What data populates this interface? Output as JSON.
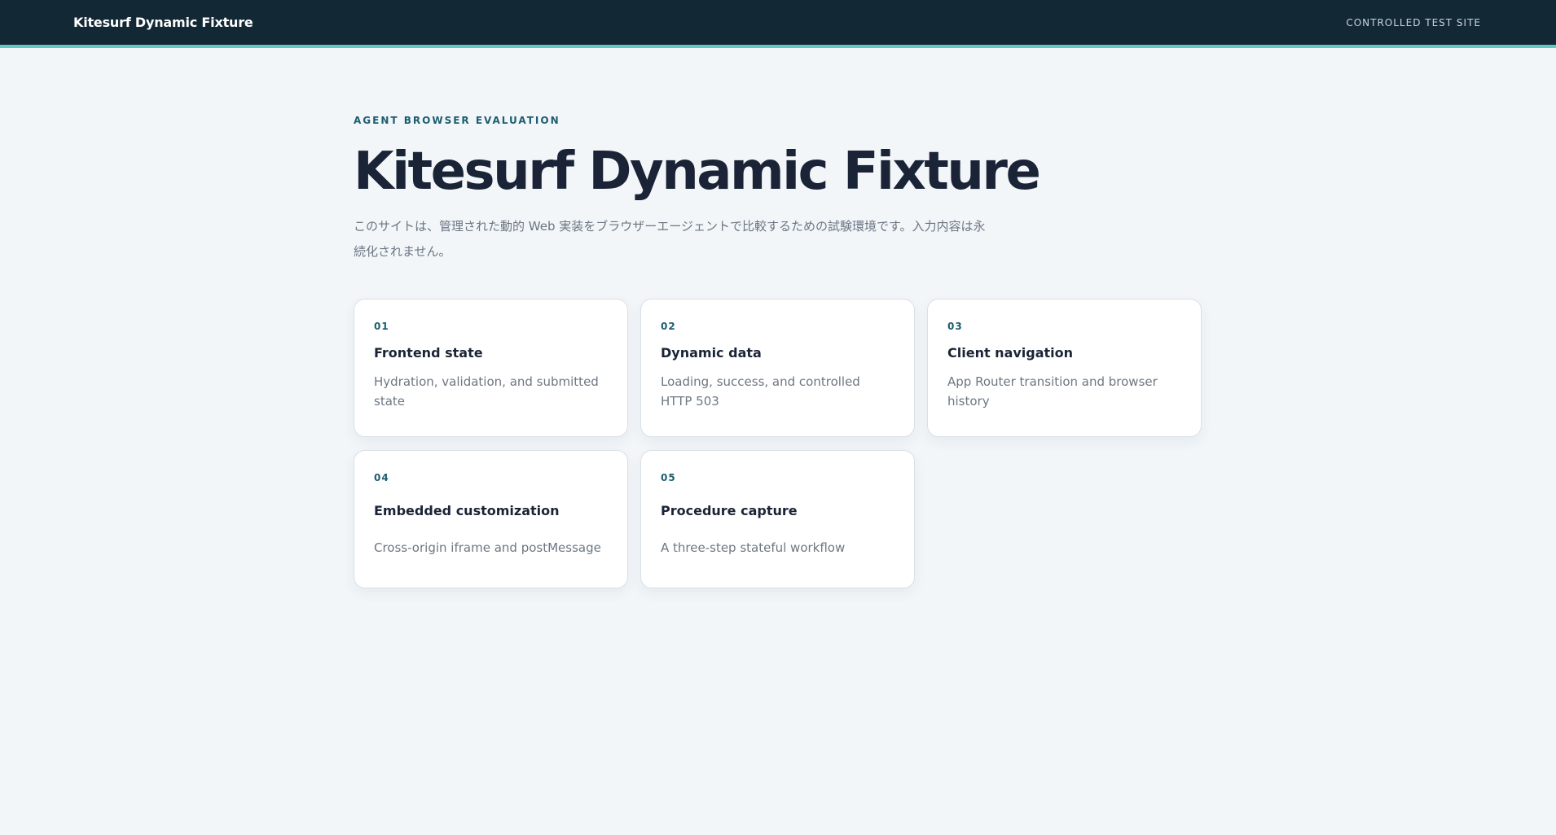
{
  "header": {
    "brand": "Kitesurf Dynamic Fixture",
    "tag": "CONTROLLED TEST SITE"
  },
  "hero": {
    "eyebrow": "AGENT BROWSER EVALUATION",
    "title": "Kitesurf Dynamic Fixture",
    "description": "このサイトは、管理された動的 Web 実装をブラウザーエージェントで比較するための試験環境です。入力内容は永続化されません。"
  },
  "cards": [
    {
      "number": "01",
      "title": "Frontend state",
      "description": "Hydration, validation, and submitted state"
    },
    {
      "number": "02",
      "title": "Dynamic data",
      "description": "Loading, success, and controlled HTTP 503"
    },
    {
      "number": "03",
      "title": "Client navigation",
      "description": "App Router transition and browser history"
    },
    {
      "number": "04",
      "title": "Embedded customization",
      "description": "Cross-origin iframe and postMessage"
    },
    {
      "number": "05",
      "title": "Procedure capture",
      "description": "A three-step stateful workflow"
    }
  ]
}
